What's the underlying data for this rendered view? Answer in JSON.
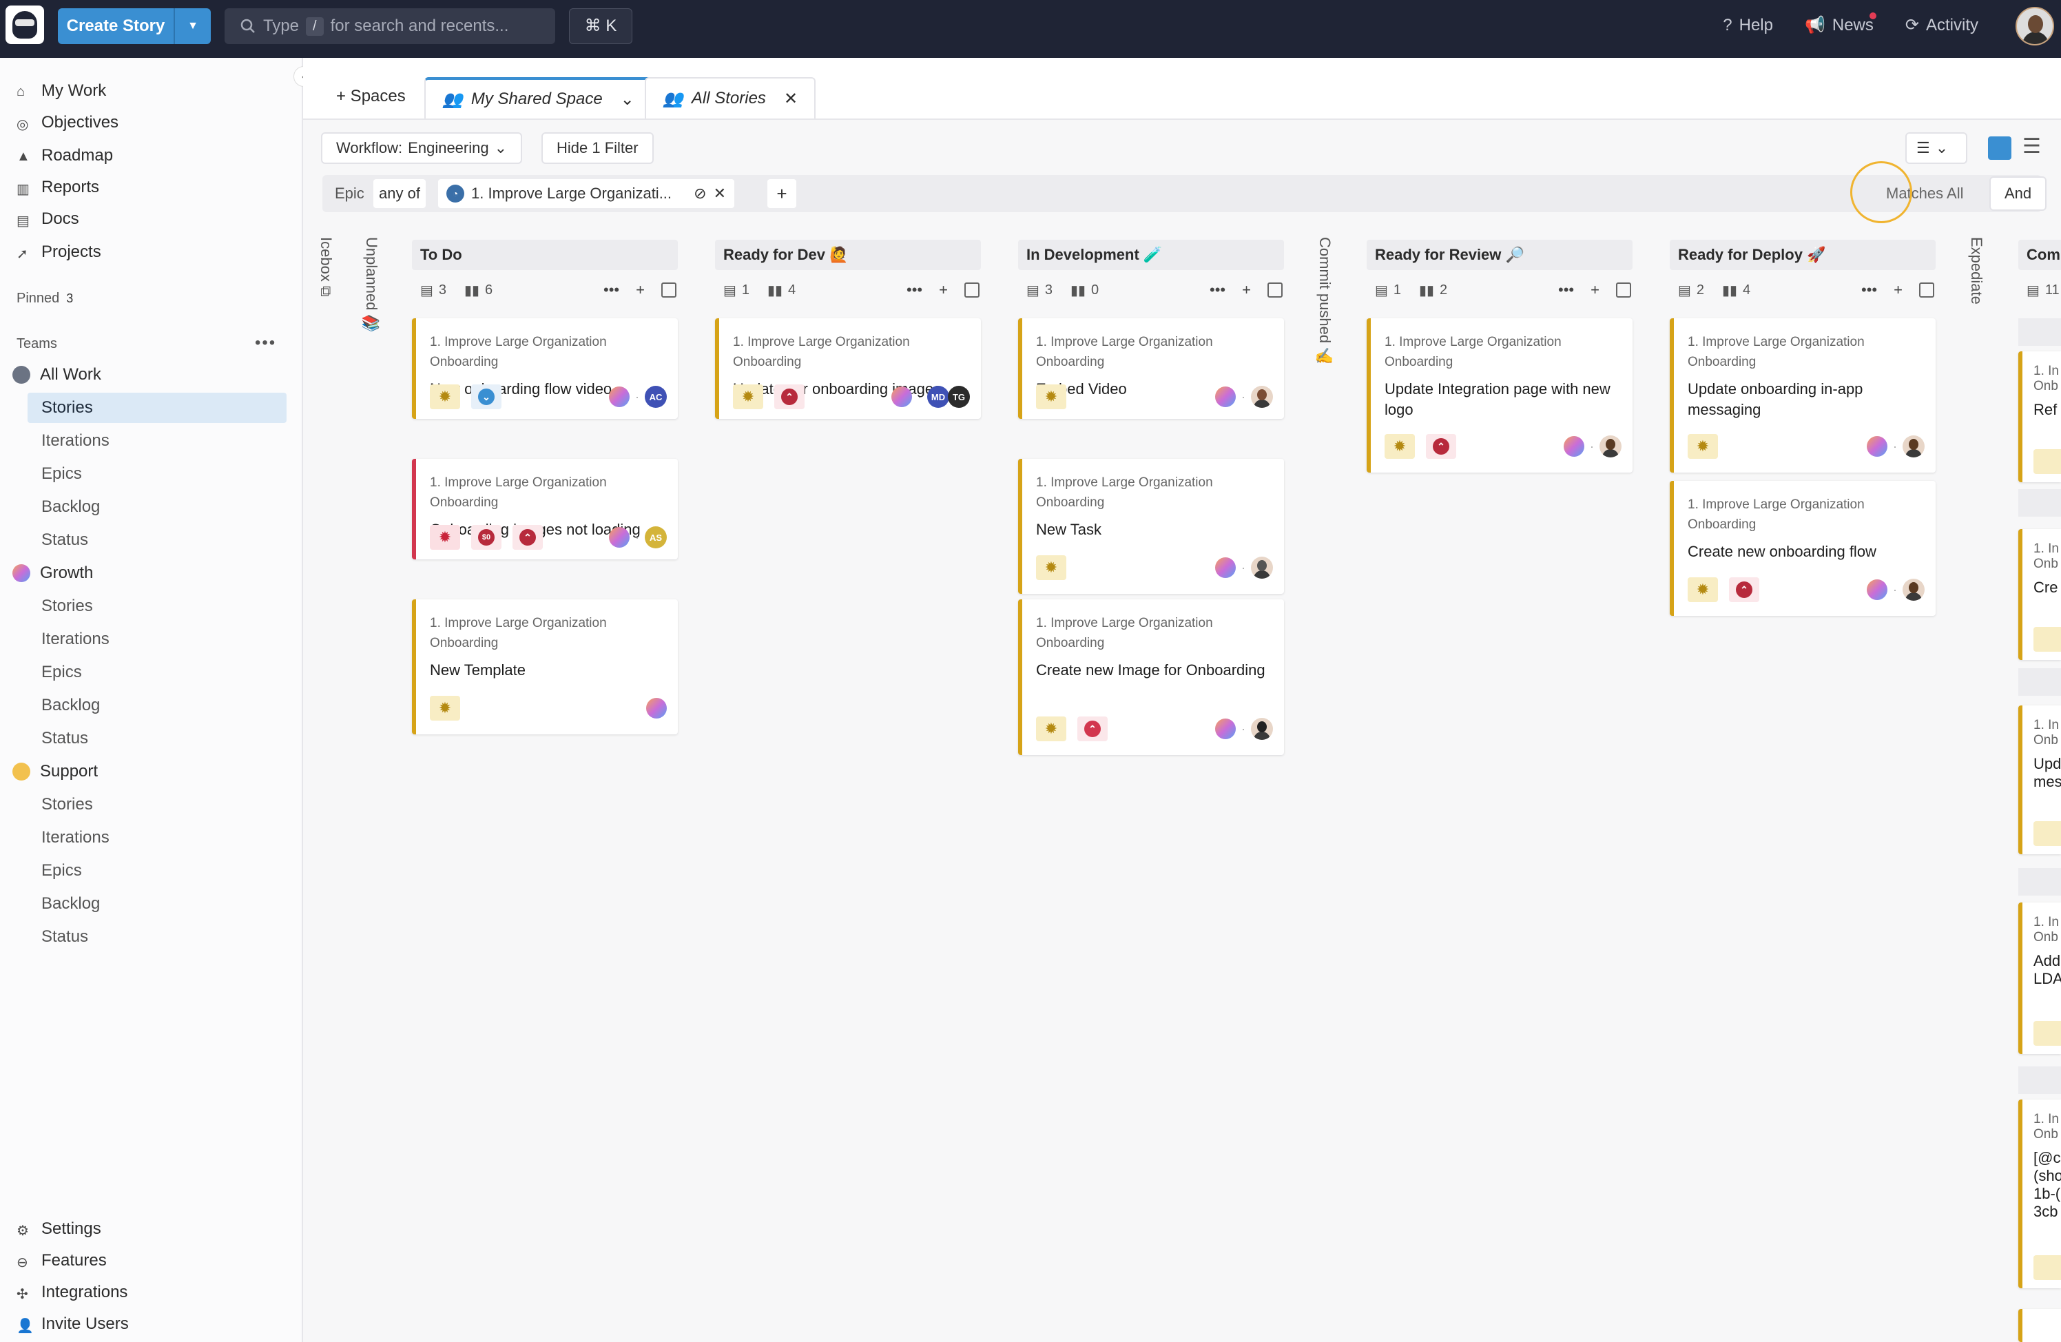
{
  "topbar": {
    "create_label": "Create Story",
    "search_type": "Type",
    "search_key": "/",
    "search_rest": "for search and recents...",
    "cmdk": "⌘ K",
    "help": "Help",
    "news": "News",
    "activity": "Activity"
  },
  "sidebar": {
    "nav": [
      "My Work",
      "Objectives",
      "Roadmap",
      "Reports",
      "Docs",
      "Projects"
    ],
    "pinned_label": "Pinned",
    "pinned_count": "3",
    "teams_label": "Teams",
    "teams": [
      {
        "name": "All Work",
        "items": [
          "Stories",
          "Iterations",
          "Epics",
          "Backlog",
          "Status"
        ]
      },
      {
        "name": "Growth",
        "items": [
          "Stories",
          "Iterations",
          "Epics",
          "Backlog",
          "Status"
        ]
      },
      {
        "name": "Support",
        "items": [
          "Stories",
          "Iterations",
          "Epics",
          "Backlog",
          "Status"
        ]
      }
    ],
    "bottom": [
      "Settings",
      "Features",
      "Integrations",
      "Invite Users"
    ]
  },
  "tabs": {
    "spaces": "+ Spaces",
    "shared_space": "My Shared Space",
    "all_stories": "All Stories"
  },
  "toolbar": {
    "workflow_prefix": "Workflow:",
    "workflow_value": "Engineering",
    "hide_filter": "Hide 1 Filter",
    "filter_field": "Epic",
    "filter_op": "any of",
    "filter_value": "1. Improve Large Organizati...",
    "matches_all": "Matches All",
    "and_label": "And"
  },
  "board": {
    "vertical_columns": [
      "Icebox",
      "Unplanned",
      "Commit pushed",
      "Expediate"
    ],
    "columns": [
      {
        "title": "To Do",
        "stories": "3",
        "points": "6",
        "cards": [
          {
            "epic": "1. Improve Large Organization Onboarding",
            "title": "New onboarding flow video",
            "assignee": "AC"
          },
          {
            "epic": "1. Improve Large Organization Onboarding",
            "title": "Onboarding images not loading",
            "estimate": "$0",
            "assignee": "AS"
          },
          {
            "epic": "1. Improve Large Organization Onboarding",
            "title": "New Template"
          }
        ]
      },
      {
        "title": "Ready for Dev 🙋",
        "stories": "1",
        "points": "4",
        "cards": [
          {
            "epic": "1. Improve Large Organization Onboarding",
            "title": "Update our onboarding images",
            "assignees": [
              "MD",
              "TG"
            ]
          }
        ]
      },
      {
        "title": "In Development 🧪",
        "stories": "3",
        "points": "0",
        "cards": [
          {
            "epic": "1. Improve Large Organization Onboarding",
            "title": "Embed Video"
          },
          {
            "epic": "1. Improve Large Organization Onboarding",
            "title": "New Task"
          },
          {
            "epic": "1. Improve Large Organization Onboarding",
            "title": "Create new Image for Onboarding"
          }
        ]
      },
      {
        "title": "Ready for Review 🔎",
        "stories": "1",
        "points": "2",
        "cards": [
          {
            "epic": "1. Improve Large Organization Onboarding",
            "title": "Update Integration page with new logo"
          }
        ]
      },
      {
        "title": "Ready for Deploy 🚀",
        "stories": "2",
        "points": "4",
        "cards": [
          {
            "epic": "1. Improve Large Organization Onboarding",
            "title": "Update onboarding in-app messaging"
          },
          {
            "epic": "1. Improve Large Organization Onboarding",
            "title": "Create new onboarding flow"
          }
        ]
      }
    ],
    "partial_column": {
      "title": "Comp",
      "stories": "11"
    },
    "partial_cards": [
      {
        "epic": "1. In Onb",
        "title": "Ref"
      },
      {
        "epic": "1. In Onb",
        "title": "Cre"
      },
      {
        "epic": "1. In Onb",
        "title": "Upd mes"
      },
      {
        "epic": "1. In Onb",
        "title": "Add LDA"
      },
      {
        "epic": "1. In Onb",
        "title": "[@c (sho 1b-( 3cb"
      }
    ]
  },
  "colors": {
    "accent": "#3a8fd2",
    "topbar": "#1f2435",
    "feature": "#d6a317",
    "bug": "#d2364e"
  }
}
